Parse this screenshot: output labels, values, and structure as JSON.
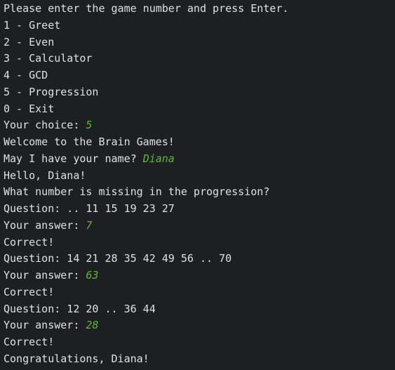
{
  "theme": {
    "background": "#1e1f22",
    "text": "#dfe1e5",
    "user_input": "#5fb832"
  },
  "lines": [
    {
      "text": "Please enter the game number and press Enter.",
      "input": ""
    },
    {
      "text": "1 - Greet",
      "input": ""
    },
    {
      "text": "2 - Even",
      "input": ""
    },
    {
      "text": "3 - Calculator",
      "input": ""
    },
    {
      "text": "4 - GCD",
      "input": ""
    },
    {
      "text": "5 - Progression",
      "input": ""
    },
    {
      "text": "0 - Exit",
      "input": ""
    },
    {
      "text": "Your choice: ",
      "input": "5"
    },
    {
      "text": "Welcome to the Brain Games!",
      "input": ""
    },
    {
      "text": "May I have your name? ",
      "input": "Diana"
    },
    {
      "text": "Hello, Diana!",
      "input": ""
    },
    {
      "text": "What number is missing in the progression?",
      "input": ""
    },
    {
      "text": "Question: .. 11 15 19 23 27",
      "input": ""
    },
    {
      "text": "Your answer: ",
      "input": "7"
    },
    {
      "text": "Correct!",
      "input": ""
    },
    {
      "text": "Question: 14 21 28 35 42 49 56 .. 70",
      "input": ""
    },
    {
      "text": "Your answer: ",
      "input": "63"
    },
    {
      "text": "Correct!",
      "input": ""
    },
    {
      "text": "Question: 12 20 .. 36 44",
      "input": ""
    },
    {
      "text": "Your answer: ",
      "input": "28"
    },
    {
      "text": "Correct!",
      "input": ""
    },
    {
      "text": "Congratulations, Diana!",
      "input": ""
    }
  ]
}
